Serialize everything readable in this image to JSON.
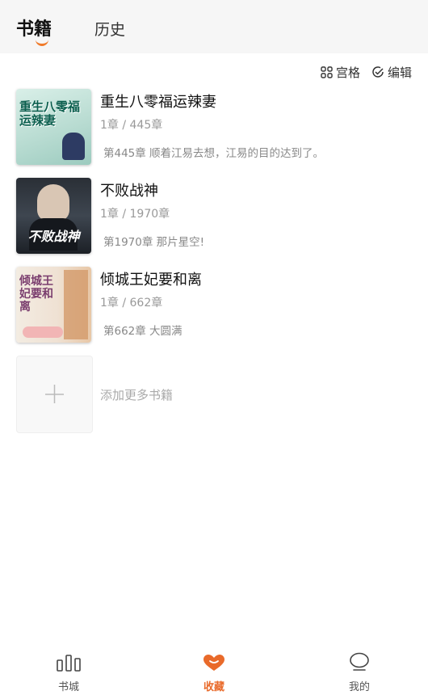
{
  "header": {
    "tabs": [
      {
        "label": "书籍",
        "active": true
      },
      {
        "label": "历史",
        "active": false
      }
    ]
  },
  "toolbar": {
    "grid_label": "宫格",
    "edit_label": "编辑"
  },
  "books": [
    {
      "title": "重生八零福运辣妻",
      "progress": "1章 / 445章",
      "latest": "第445章  顺着江易去想，江易的目的达到了。",
      "cover_text": "重生八零福运辣妻"
    },
    {
      "title": "不败战神",
      "progress": "1章 / 1970章",
      "latest": "第1970章  那片星空!",
      "cover_text": "不败战神"
    },
    {
      "title": "倾城王妃要和离",
      "progress": "1章 / 662章",
      "latest": "第662章  大圆满",
      "cover_text": "倾城王妃要和离"
    }
  ],
  "add_more_label": "添加更多书籍",
  "bottom_nav": [
    {
      "label": "书城",
      "icon": "bar-chart-icon",
      "active": false
    },
    {
      "label": "收藏",
      "icon": "heart-icon",
      "active": true
    },
    {
      "label": "我的",
      "icon": "chat-bubble-icon",
      "active": false
    }
  ],
  "colors": {
    "accent": "#e96a2a",
    "header_bg": "#f6f6f6"
  }
}
